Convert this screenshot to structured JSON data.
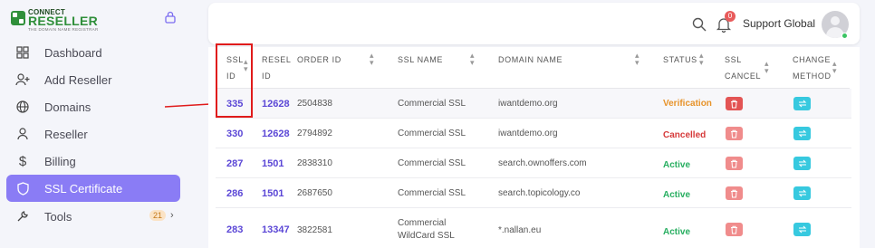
{
  "brand": {
    "line1": "CONNECT",
    "line2": "RESELLER",
    "line3": "THE DOMAIN NAME REGISTRAR"
  },
  "sidebar": {
    "items": [
      {
        "label": "Dashboard",
        "icon": "grid-icon"
      },
      {
        "label": "Add Reseller",
        "icon": "add-user-icon"
      },
      {
        "label": "Domains",
        "icon": "globe-icon"
      },
      {
        "label": "Reseller",
        "icon": "user-icon"
      },
      {
        "label": "Billing",
        "icon": "dollar-icon"
      },
      {
        "label": "SSL Certificate",
        "icon": "shield-icon",
        "active": true
      },
      {
        "label": "Tools",
        "icon": "wrench-icon",
        "badge": "21"
      }
    ]
  },
  "header": {
    "notifications": "0",
    "user_name": "Support Global"
  },
  "table": {
    "columns": {
      "ssl_id": [
        "SSL",
        "ID"
      ],
      "reseller_id": [
        "RESEL",
        "ID"
      ],
      "order_id": "ORDER ID",
      "ssl_name": "SSL NAME",
      "domain_name": "DOMAIN NAME",
      "status": "STATUS",
      "ssl_cancel": [
        "SSL",
        "CANCEL"
      ],
      "change_method": [
        "CHANGE",
        "METHOD"
      ]
    },
    "rows": [
      {
        "ssl_id": "335",
        "reseller_id": "12628",
        "order_id": "2504838",
        "ssl_name": "Commercial SSL",
        "domain": "iwantdemo.org",
        "status": "Verification"
      },
      {
        "ssl_id": "330",
        "reseller_id": "12628",
        "order_id": "2794892",
        "ssl_name": "Commercial SSL",
        "domain": "iwantdemo.org",
        "status": "Cancelled"
      },
      {
        "ssl_id": "287",
        "reseller_id": "1501",
        "order_id": "2838310",
        "ssl_name": "Commercial SSL",
        "domain": "search.ownoffers.com",
        "status": "Active"
      },
      {
        "ssl_id": "286",
        "reseller_id": "1501",
        "order_id": "2687650",
        "ssl_name": "Commercial SSL",
        "domain": "search.topicology.co",
        "status": "Active"
      },
      {
        "ssl_id": "283",
        "reseller_id": "13347",
        "order_id": "3822581",
        "ssl_name_line1": "Commercial",
        "ssl_name_line2": "WildCard SSL",
        "domain": "*.nallan.eu",
        "status": "Active"
      }
    ]
  },
  "colors": {
    "accent": "#8a7cf5",
    "link": "#5b47d6",
    "verification": "#e7932a",
    "cancelled": "#d63a3a",
    "active": "#27ae60",
    "cancel_button": "#f08c8c",
    "method_button": "#37c9df",
    "highlight": "#e01b1b"
  }
}
